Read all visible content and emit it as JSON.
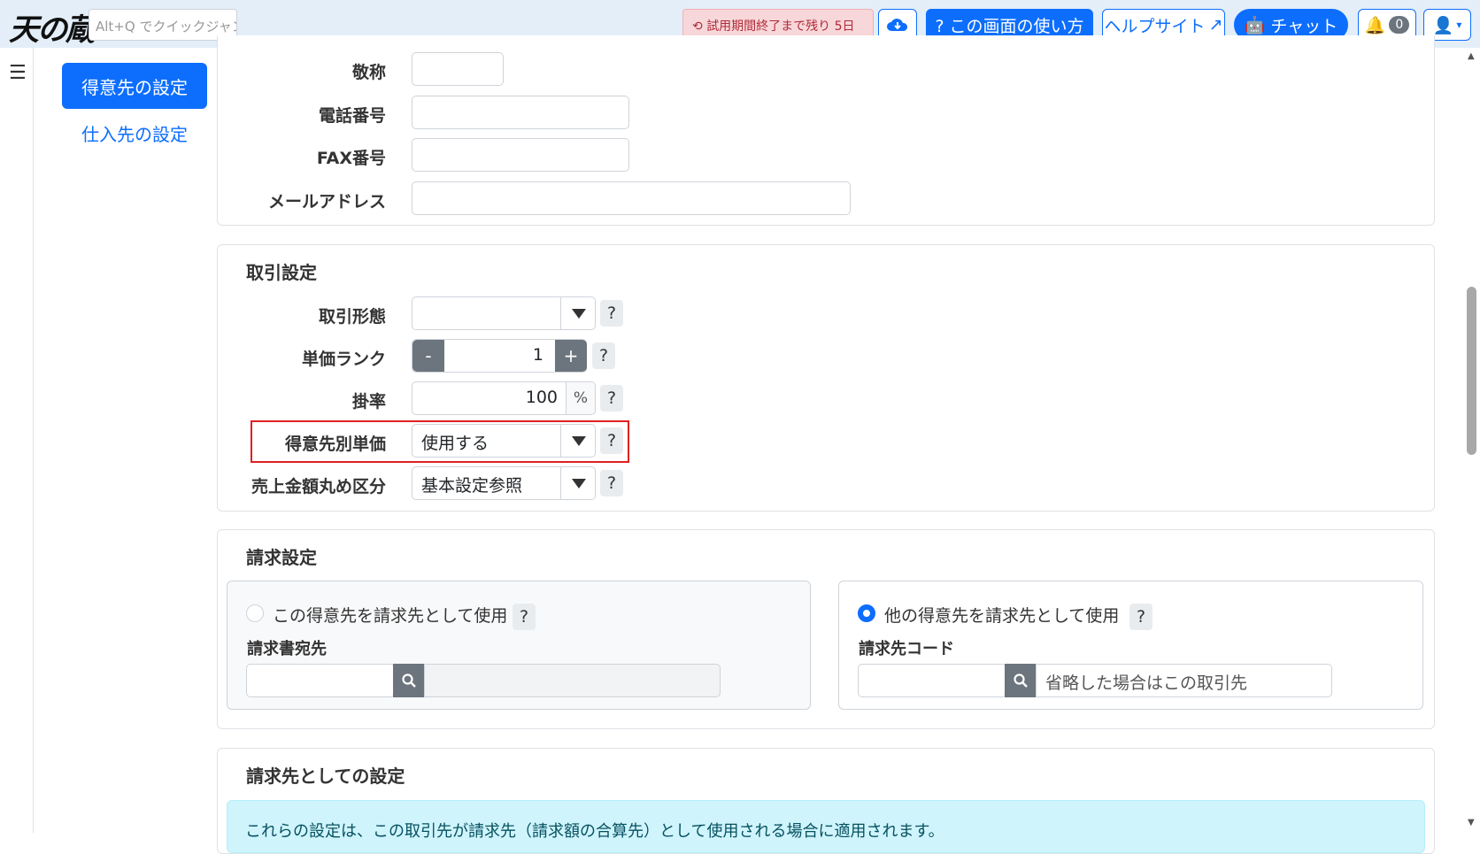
{
  "header": {
    "logo": "天の蔵",
    "quick_jump_placeholder": "Alt+Q でクイックジャンプ",
    "trial_label": "試用期間終了まで残り 5日",
    "usage_label": "? この画面の使い方",
    "help_label": "ヘルプサイト",
    "chat_label": "チャット",
    "notification_count": "0"
  },
  "sidenav": {
    "active_label": "得意先の設定",
    "link_label": "仕入先の設定"
  },
  "contact": {
    "honorific_label": "敬称",
    "phone_label": "電話番号",
    "fax_label": "FAX番号",
    "email_label": "メールアドレス"
  },
  "trade": {
    "title": "取引設定",
    "type_label": "取引形態",
    "type_value": "",
    "price_rank_label": "単価ランク",
    "price_rank_value": "1",
    "rate_label": "掛率",
    "rate_value": "100",
    "rate_unit": "%",
    "customer_price_label": "得意先別単価",
    "customer_price_value": "使用する",
    "rounding_label": "売上金額丸め区分",
    "rounding_value": "基本設定参照",
    "help_mark": "?",
    "minus": "-",
    "plus": "+"
  },
  "billing": {
    "title": "請求設定",
    "option_self_label": "この得意先を請求先として使用",
    "invoice_to_label": "請求書宛先",
    "option_other_label": "他の得意先を請求先として使用",
    "billing_code_label": "請求先コード",
    "billing_code_hint": "省略した場合はこの取引先"
  },
  "billing_as": {
    "title": "請求先としての設定",
    "notice": "これらの設定は、この取引先が請求先（請求額の合算先）として使用される場合に適用されます。"
  },
  "colors": {
    "primary": "#0d6efd",
    "highlight": "#e02020",
    "secondary": "#6c757d",
    "info_bg": "#cff4fc"
  }
}
